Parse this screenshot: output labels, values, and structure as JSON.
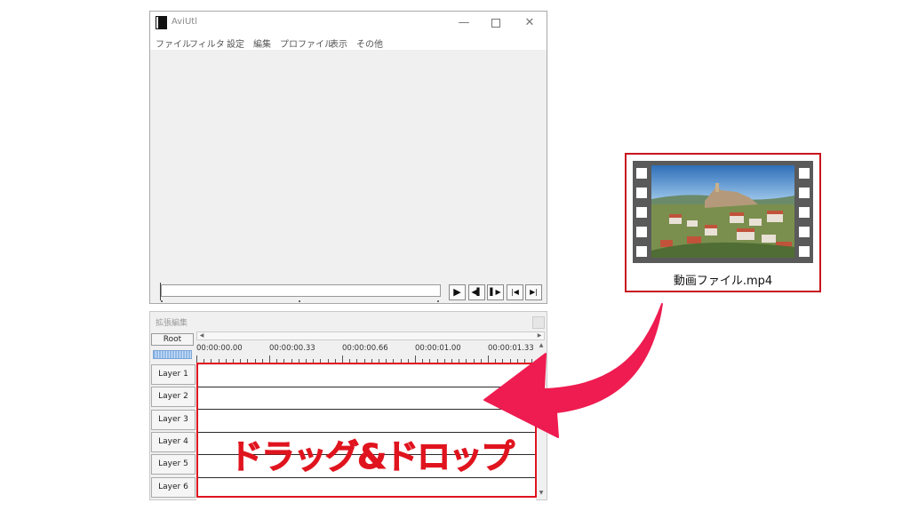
{
  "main_window": {
    "title": "AviUtl",
    "controls": {
      "minimize": "—",
      "close": "✕"
    },
    "menu": [
      "ファイル",
      "フィルタ",
      "設定",
      "編集",
      "プロファイル",
      "表示",
      "その他"
    ],
    "playback_buttons": [
      {
        "name": "play-icon",
        "glyph": "▶"
      },
      {
        "name": "previous-frame-icon",
        "glyph": "◀▌"
      },
      {
        "name": "next-frame-icon",
        "glyph": "▌▶"
      },
      {
        "name": "jump-start-icon",
        "glyph": "|◀"
      },
      {
        "name": "jump-end-icon",
        "glyph": "▶|"
      }
    ]
  },
  "extended_edit": {
    "title": "拡張編集",
    "root_label": "Root",
    "time_labels": [
      "00:00:00.00",
      "00:00:00.33",
      "00:00:00.66",
      "00:00:01.00",
      "00:00:01.33"
    ],
    "layers": [
      "Layer 1",
      "Layer 2",
      "Layer 3",
      "Layer 4",
      "Layer 5",
      "Layer 6"
    ]
  },
  "overlay": {
    "drag_drop_text": "ドラッグ&ドロップ",
    "highlight_color": "#e0141e",
    "arrow_color": "#ee1c50"
  },
  "file_card": {
    "filename": "動画ファイル.mp4",
    "icon": "video-file-icon"
  }
}
